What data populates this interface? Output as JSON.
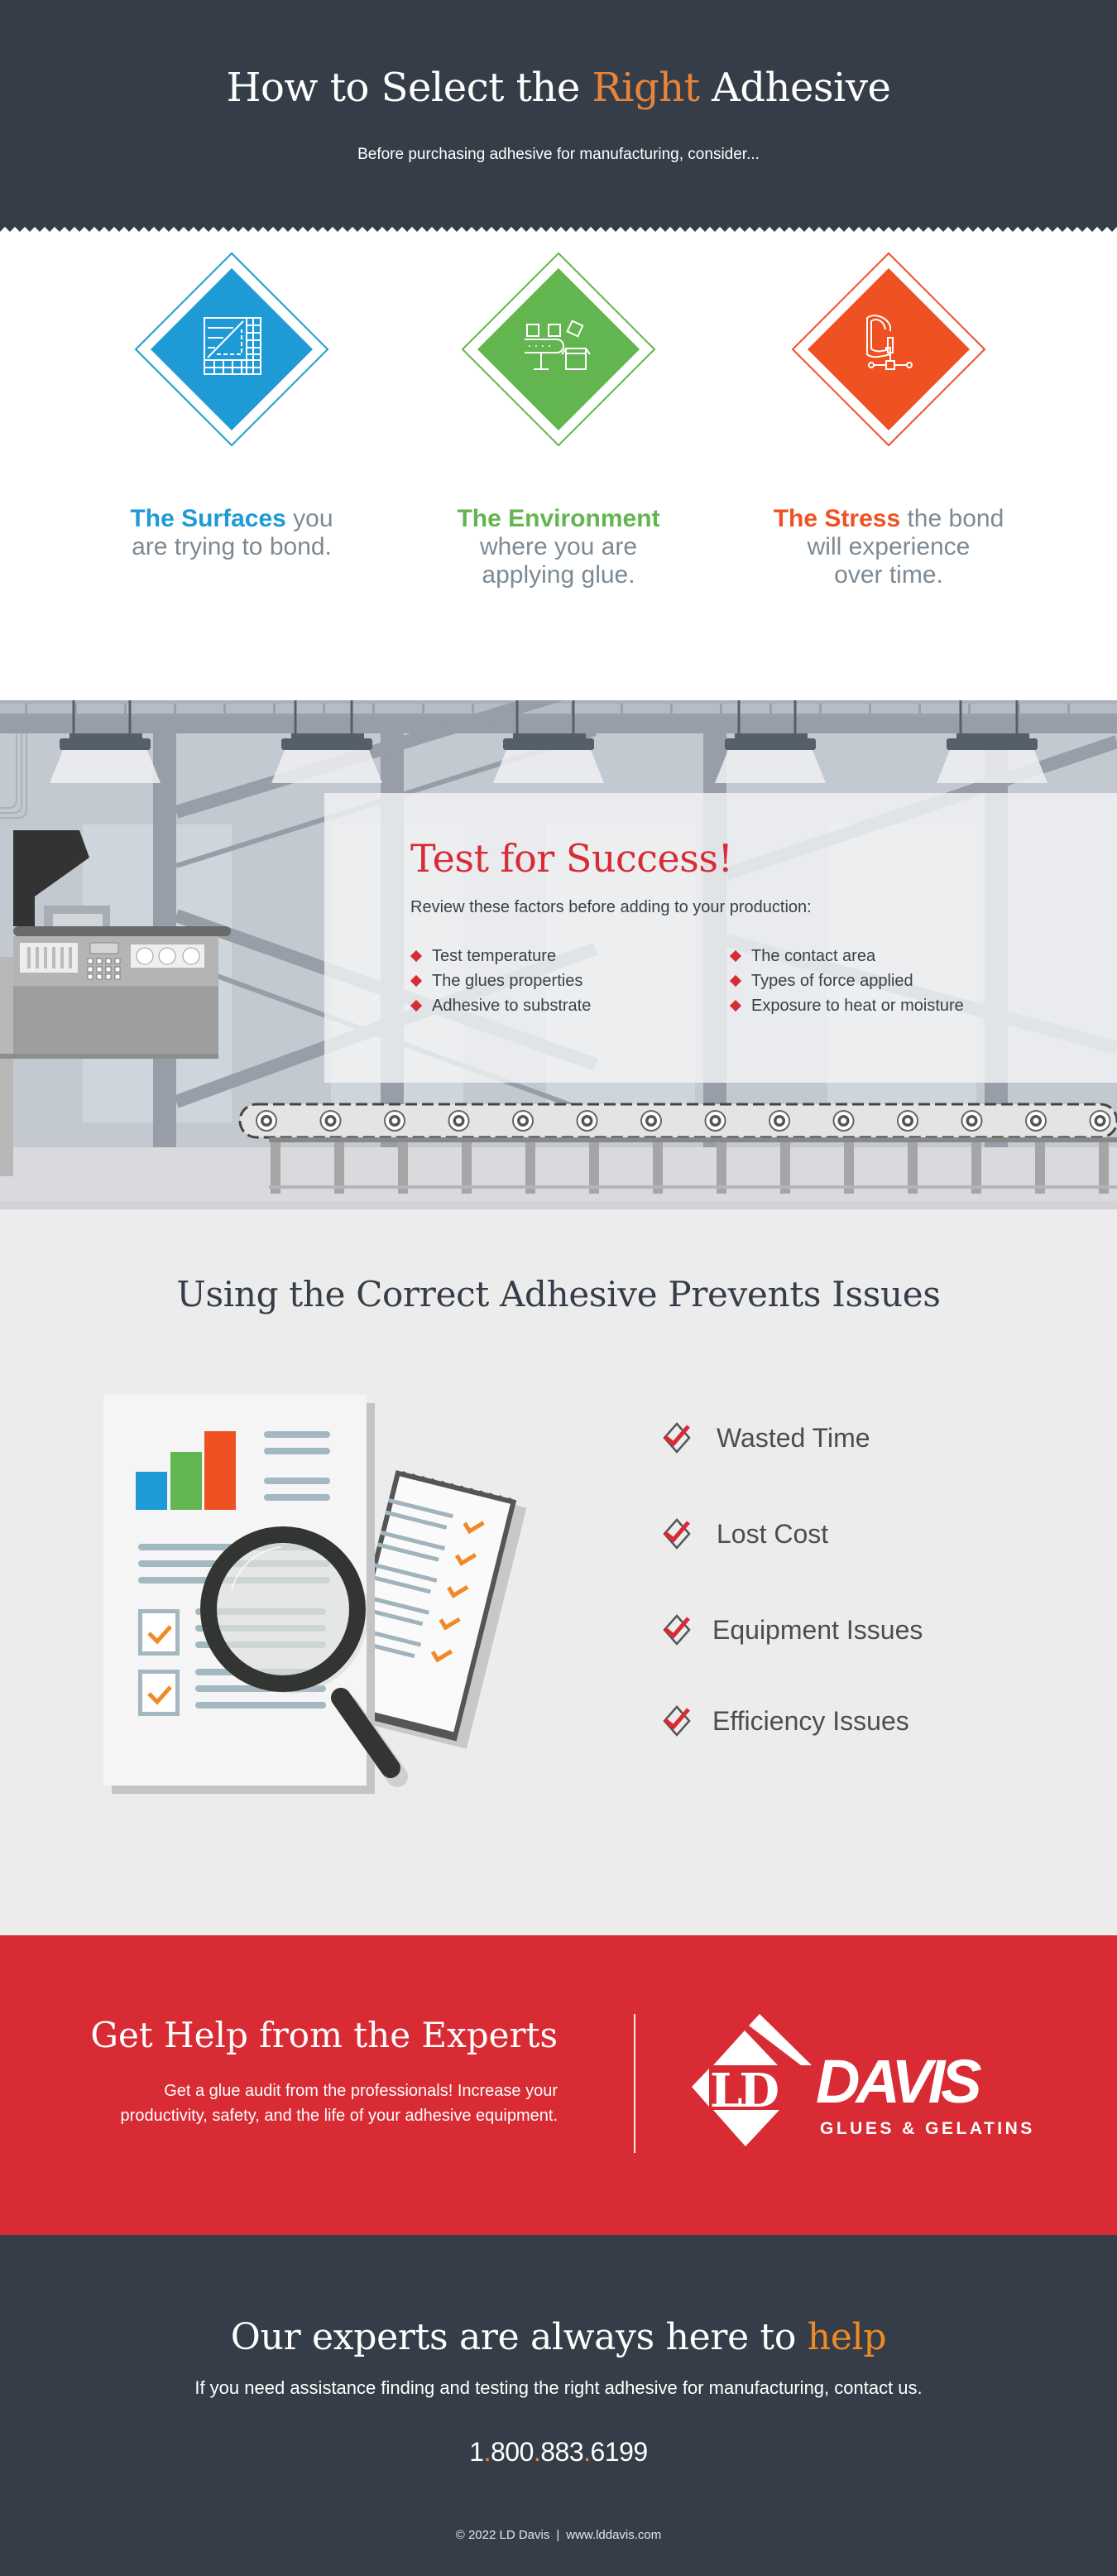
{
  "header": {
    "title_before": "How to Select the ",
    "title_accent": "Right",
    "title_after": " Adhesive",
    "subtitle": "Before purchasing adhesive for manufacturing, consider..."
  },
  "considerations": [
    {
      "highlight": "The Surfaces",
      "rest_line1": " you",
      "rest_line2": "are trying to bond.",
      "rest_line3": "",
      "color": "#1e9ad6",
      "icon": "tile-surfaces-icon"
    },
    {
      "highlight": "The Environment",
      "rest_line1": "",
      "rest_line2": "where you are",
      "rest_line3": "applying glue.",
      "color": "#62b54f",
      "icon": "conveyor-boxes-icon"
    },
    {
      "highlight": "The Stress",
      "rest_line1": " the bond",
      "rest_line2": "will experience",
      "rest_line3": "over time.",
      "color": "#f05123",
      "icon": "c-clamp-icon"
    }
  ],
  "test": {
    "title": "Test for Success!",
    "intro": "Review these factors before adding to your production:",
    "col1": [
      "Test temperature",
      "The glues properties",
      "Adhesive to substrate"
    ],
    "col2": [
      "The contact area",
      "Types of force applied",
      "Exposure to heat or moisture"
    ]
  },
  "issues": {
    "title": "Using the Correct Adhesive Prevents Issues",
    "items": [
      "Wasted Time",
      "Lost Cost",
      "Equipment Issues",
      "Efficiency Issues"
    ]
  },
  "experts": {
    "title": "Get Help from the Experts",
    "body": "Get a glue audit from the professionals! Increase your productivity, safety, and the life of your adhesive equipment.",
    "logo_initials": "LD",
    "logo_name": "DAVIS",
    "logo_tagline": "GLUES & GELATINS"
  },
  "footer": {
    "title_before": "Our experts are always here to ",
    "title_accent": "help",
    "assist": "If you need assistance finding and testing the right adhesive for manufacturing, contact us.",
    "phone_parts": [
      "1",
      "800",
      "883",
      "6199"
    ],
    "copyright": "© 2022 LD Davis",
    "separator": "|",
    "website": "www.lddavis.com"
  },
  "colors": {
    "dark": "#353e48",
    "orange": "#e8843a",
    "red": "#d92b34",
    "blue": "#1e9ad6",
    "green": "#62b54f",
    "orange_red": "#f05123"
  }
}
